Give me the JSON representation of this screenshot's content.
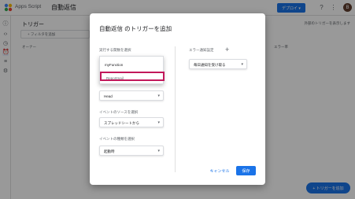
{
  "app": {
    "name": "Apps Script",
    "project_title": "自動返信",
    "deploy_label": "デプロイ ▾",
    "avatar_initial": "B"
  },
  "main": {
    "title": "トリガー",
    "note": "外部のトリガーを表示します",
    "filter_label": "+ フィルタを追加",
    "columns": [
      "オーナー",
      "エラー率"
    ]
  },
  "fab_label": "+ トリガーを追加",
  "dialog": {
    "title": "自動返信 のトリガーを追加",
    "function_label": "実行する関数を選択",
    "function_options": [
      "myFunction",
      "Reportmail"
    ],
    "deployment_value": "Head",
    "event_source_label": "イベントのソースを選択",
    "event_source_value": "スプレッドシートから",
    "event_type_label": "イベントの種類を選択",
    "event_type_value": "起動時",
    "error_notify_label": "エラー通知設定",
    "error_notify_value": "毎日通知を受け取る",
    "cancel_label": "キャンセル",
    "save_label": "保存"
  },
  "colors": {
    "accent": "#1a73e8",
    "highlight": "#c2185b"
  }
}
